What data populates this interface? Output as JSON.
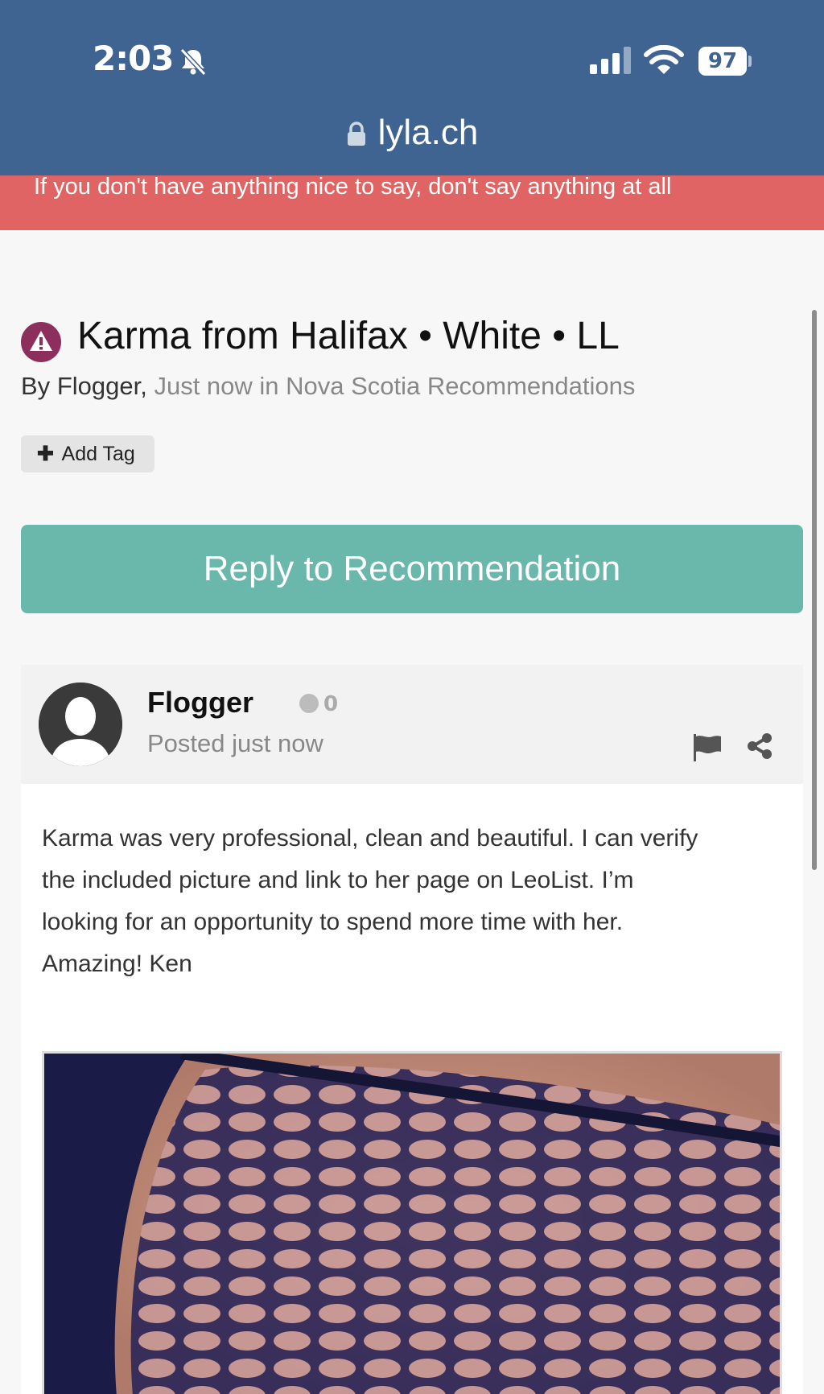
{
  "status_bar": {
    "time": "2:03",
    "battery": "97"
  },
  "browser": {
    "url": "lyla.ch"
  },
  "banner": {
    "text": "If you don't have anything nice to say, don't say anything at all"
  },
  "topic": {
    "title": "Karma from Halifax • White • LL",
    "by_label": "By",
    "author": "Flogger,",
    "meta": "Just now in Nova Scotia Recommendations"
  },
  "add_tag": {
    "label": "Add Tag"
  },
  "reply_button": {
    "label": "Reply to Recommendation"
  },
  "post": {
    "author": "Flogger",
    "reputation": "0",
    "posted": "Posted just now",
    "lines": [
      "Karma was very professional, clean and beautiful. I can verify",
      "the included picture and link to her page on LeoList.  I’m",
      "looking for an opportunity to spend more time with her.",
      "Amazing!  Ken"
    ]
  },
  "colors": {
    "header": "#3f6491",
    "banner": "#e06464",
    "reply_button": "#6ab7ac",
    "warning_icon": "#8c2f5c"
  },
  "icons": [
    "bell-slash-icon",
    "cellular-signal-icon",
    "wifi-icon",
    "battery-icon",
    "lock-icon",
    "warning-icon",
    "plus-icon",
    "flag-icon",
    "share-icon"
  ]
}
